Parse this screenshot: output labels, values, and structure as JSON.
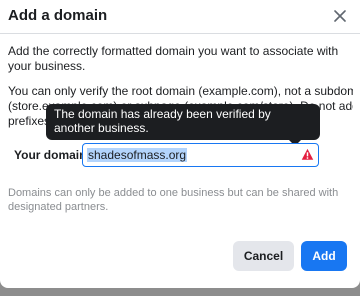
{
  "dialog": {
    "title": "Add a domain",
    "intro": "Add the correctly formatted domain you want to associate with your business.",
    "hint_lines": [
      "You can only verify the root domain (example.com), not a subdomain",
      "(store.example.com) or subpage (example.com/store). Do not add",
      "prefixes"
    ],
    "tooltip": "The domain has already been verified by another business.",
    "field_label": "Your domain",
    "domain_value": "shadesofmass.org",
    "note": "Domains can only be added to one business but can be shared with designated partners.",
    "cancel_label": "Cancel",
    "add_label": "Add"
  },
  "icons": {
    "close": "close-icon",
    "warning": "warning-icon"
  },
  "colors": {
    "accent": "#1877f2",
    "error": "#e41e3f",
    "tooltip_bg": "#1c1e21",
    "secondary_button": "#e4e6eb",
    "muted_text": "#8a8d91"
  }
}
